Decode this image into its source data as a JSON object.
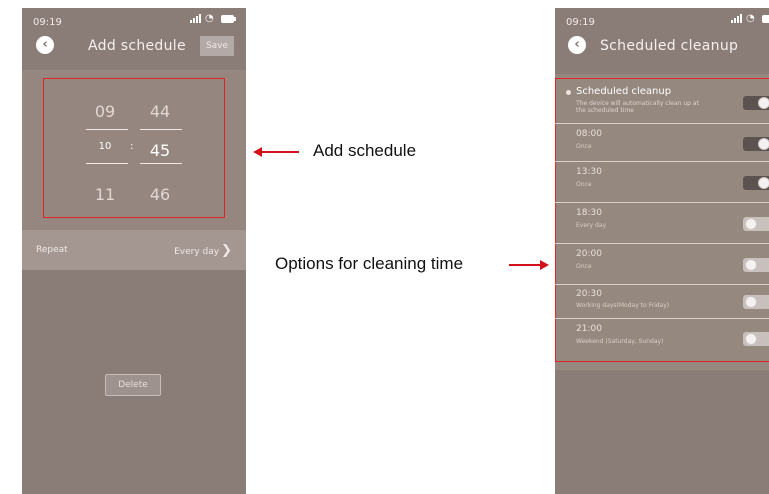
{
  "left_screen": {
    "status_time": "09:19",
    "back_icon": "chevron-left-icon",
    "title": "Add schedule",
    "save_label": "Save",
    "picker": {
      "hours": [
        "09",
        "10",
        "11"
      ],
      "minutes": [
        "44",
        "45",
        "46"
      ],
      "separator": ":"
    },
    "repeat_label": "Repeat",
    "repeat_value": "Every day",
    "delete_label": "Delete"
  },
  "right_screen": {
    "status_time": "09:19",
    "back_icon": "chevron-left-icon",
    "title": "Scheduled cleanup",
    "header": {
      "title": "Scheduled cleanup",
      "subtitle": "The device will automatically clean up at the scheduled time",
      "enabled": true
    },
    "items": [
      {
        "time": "08:00",
        "repeat": "Once",
        "enabled": true
      },
      {
        "time": "13:30",
        "repeat": "Once",
        "enabled": true
      },
      {
        "time": "18:30",
        "repeat": "Every day",
        "enabled": false
      },
      {
        "time": "20:00",
        "repeat": "Once",
        "enabled": false
      },
      {
        "time": "20:30",
        "repeat": "Working days(Moday to Friday)",
        "enabled": false
      },
      {
        "time": "21:00",
        "repeat": "Weekend (Saturday, Sunday)",
        "enabled": false
      }
    ]
  },
  "annotations": {
    "add_schedule": "Add schedule",
    "options": "Options for cleaning time",
    "arrow_color": "#d1121a",
    "highlight_color": "#e0242a"
  },
  "colors": {
    "screen_bg": "#8a7c77",
    "panel_bg": "#95877f"
  }
}
